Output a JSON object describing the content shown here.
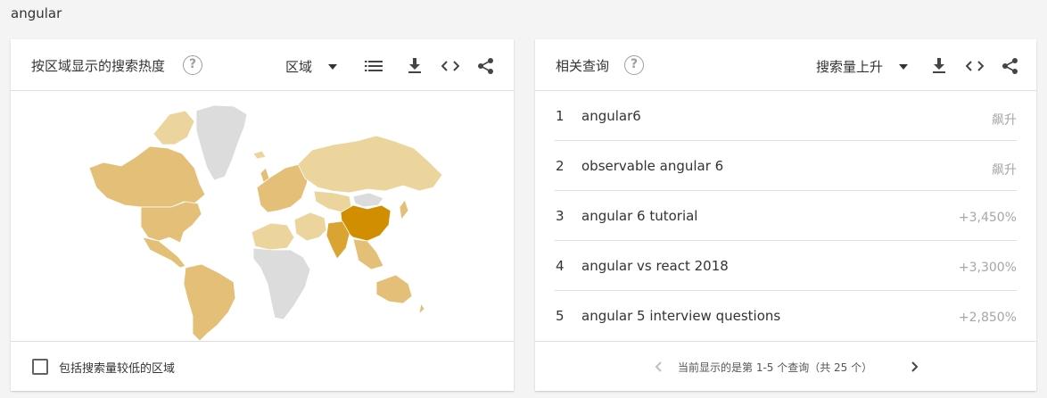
{
  "search_term": "angular",
  "region_card": {
    "title": "按区域显示的搜索热度",
    "help_icon": "help-circle-icon",
    "resolution_select": "区域",
    "icons": [
      "list-icon",
      "download-icon",
      "embed-code-icon",
      "share-icon"
    ],
    "include_low_volume_label": "包括搜索量较低的区域",
    "colors": {
      "highest": "#d18f00",
      "mid": "#e3bf77",
      "low": "#ecd59c",
      "no_data": "#dcdcdc"
    }
  },
  "related_card": {
    "title": "相关查询",
    "help_icon": "help-circle-icon",
    "sort_select": "搜索量上升",
    "icons": [
      "download-icon",
      "embed-code-icon",
      "share-icon"
    ],
    "queries": [
      {
        "rank": "1",
        "text": "angular6",
        "value": "飙升"
      },
      {
        "rank": "2",
        "text": "observable angular 6",
        "value": "飙升"
      },
      {
        "rank": "3",
        "text": "angular 6 tutorial",
        "value": "+3,450%"
      },
      {
        "rank": "4",
        "text": "angular vs react 2018",
        "value": "+3,300%"
      },
      {
        "rank": "5",
        "text": "angular 5 interview questions",
        "value": "+2,850%"
      }
    ],
    "pagination": "当前显示的是第 1-5 个查询（共 25 个）"
  }
}
